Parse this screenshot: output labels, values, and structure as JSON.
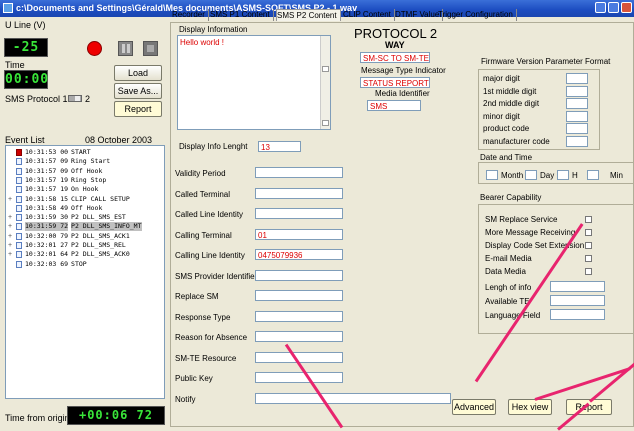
{
  "window": {
    "title": "c:\\Documents and Settings\\Gérald\\Mes documents\\ASMS-SOFT\\SMS P2 - 1.wav"
  },
  "left": {
    "uline_label": "U Line (V)",
    "uline_value": "-25",
    "time_label": "Time",
    "time_value": "00:00",
    "load": "Load",
    "save_as": "Save As...",
    "report": "Report",
    "sms_protocol_label": "SMS Protocol 1",
    "sms_protocol_right": "2",
    "event_list_label": "Event List",
    "event_list_date": "08 October 2003",
    "time_from_origin_label": "Time from origin",
    "time_from_origin_value": "+00:06  72"
  },
  "events": [
    {
      "time": "10:31:53 00",
      "name": "START",
      "icon": "red",
      "pm": ""
    },
    {
      "time": "10:31:57 09",
      "name": "Ring Start",
      "icon": "doc",
      "pm": ""
    },
    {
      "time": "10:31:57 09",
      "name": "Off Hook",
      "icon": "doc",
      "pm": ""
    },
    {
      "time": "10:31:57 19",
      "name": "Ring Stop",
      "icon": "doc",
      "pm": ""
    },
    {
      "time": "10:31:57 19",
      "name": "On Hook",
      "icon": "doc",
      "pm": ""
    },
    {
      "time": "10:31:58 15",
      "name": "CLIP CALL SETUP",
      "icon": "doc",
      "pm": "+"
    },
    {
      "time": "10:31:58 49",
      "name": "Off Hook",
      "icon": "doc",
      "pm": ""
    },
    {
      "time": "10:31:59 30",
      "name": "P2 DLL_SMS_EST",
      "icon": "doc",
      "pm": "+"
    },
    {
      "time": "10:31:59 72",
      "name": "P2 DLL_SMS_INFO_MT",
      "icon": "doc",
      "pm": "+",
      "selected": true
    },
    {
      "time": "10:32:00 79",
      "name": "P2 DLL_SMS_ACK1",
      "icon": "doc",
      "pm": "+"
    },
    {
      "time": "10:32:01 27",
      "name": "P2 DLL_SMS_REL",
      "icon": "doc",
      "pm": "+"
    },
    {
      "time": "10:32:01 64",
      "name": "P2 DLL_SMS_ACK0",
      "icon": "doc",
      "pm": "+"
    },
    {
      "time": "10:32:03 69",
      "name": "STOP",
      "icon": "doc",
      "pm": ""
    }
  ],
  "tabs": [
    "Recorder",
    "SMS P1 Content",
    "SMS P2 Content",
    "CLIP Content",
    "DTMF Value",
    "Trigger Configuration"
  ],
  "form": {
    "display_info_label": "Display Information",
    "display_info_value": "Hello world !",
    "display_info_len_label": "Display Info Lenght",
    "display_info_len_value": "13",
    "protocol_title": "PROTOCOL 2",
    "way_label": "WAY",
    "way_value": "SM-SC TO SM-TE",
    "mti_label": "Message Type Indicator",
    "mti_value": "STATUS REPORT",
    "media_label": "Media Identifier",
    "media_value": "SMS",
    "fields": [
      {
        "label": "Validity Period",
        "value": ""
      },
      {
        "label": "Called Terminal",
        "value": ""
      },
      {
        "label": "Called Line Identity",
        "value": ""
      },
      {
        "label": "Calling Terminal",
        "value": "01"
      },
      {
        "label": "Calling Line Identity",
        "value": "0475079936"
      },
      {
        "label": "SMS Provider Identifier",
        "value": ""
      },
      {
        "label": "Replace SM",
        "value": ""
      },
      {
        "label": "Response Type",
        "value": ""
      },
      {
        "label": "Reason for Absence",
        "value": ""
      },
      {
        "label": "SM-TE Resource",
        "value": ""
      },
      {
        "label": "Public Key",
        "value": ""
      },
      {
        "label": "Notify",
        "value": ""
      }
    ]
  },
  "firmware": {
    "title": "Firmware Version Parameter Format",
    "rows": [
      "major digit",
      "1st middle digit",
      "2nd middle digit",
      "minor digit",
      "product code",
      "manufacturer code"
    ]
  },
  "datetime": {
    "title": "Date and Time",
    "month": "Month",
    "day": "Day",
    "h": "H",
    "min": "Min"
  },
  "bearer": {
    "title": "Bearer Capability",
    "checks": [
      "SM Replace Service",
      "More Message Receiving",
      "Display Code Set Extension",
      "E-mail Media",
      "Data Media"
    ],
    "inputs": [
      "Lengh of info",
      "Available TE",
      "Language Field"
    ]
  },
  "bottom_buttons": {
    "advanced": "Advanced",
    "hex_view": "Hex view",
    "report": "Report"
  },
  "colors": {
    "accent_red": "#d00000",
    "arrow": "#e8246e",
    "lcd_green": "#39e639"
  }
}
